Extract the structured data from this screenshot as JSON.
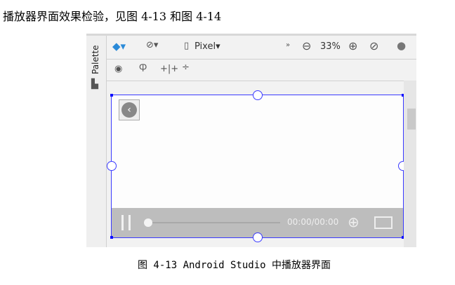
{
  "heading": "播放器界面效果检验，见图 4-13 和图 4-14",
  "caption": "图 4-13 Android Studio 中播放器界面",
  "screenshot": {
    "palette_label": "Palette",
    "toolbar": {
      "device": "Pixel",
      "zoom": "33%",
      "more": "»"
    },
    "player": {
      "time": "00:00/00:00",
      "progress": 0
    },
    "colors": {
      "selection": "#3a3aff",
      "layers_icon": "#2a8ad8",
      "controls_bg": "#bdbdbd"
    }
  }
}
